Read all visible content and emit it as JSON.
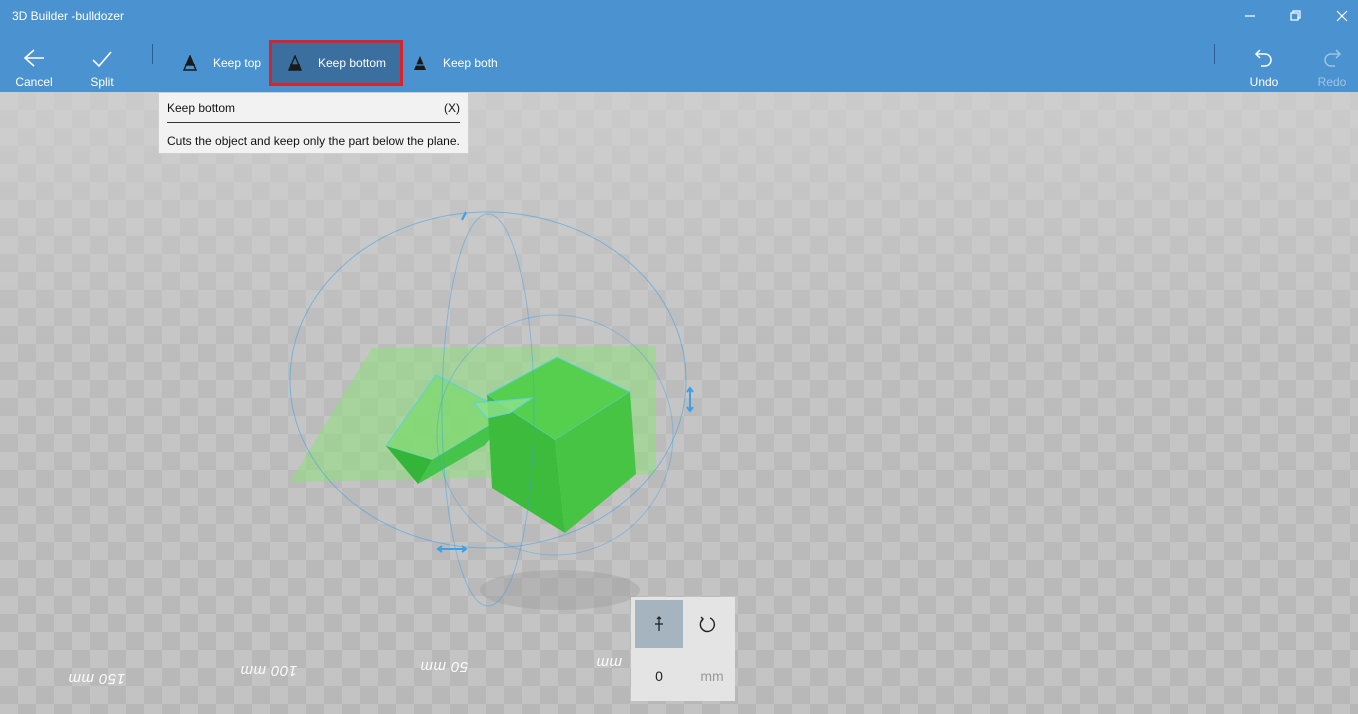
{
  "window": {
    "title": "3D Builder -bulldozer",
    "controls": [
      "minimize-icon",
      "restore-icon",
      "close-icon"
    ]
  },
  "toolbar": {
    "cancel_label": "Cancel",
    "split_label": "Split",
    "keep_top_label": "Keep top",
    "keep_bottom_label": "Keep bottom",
    "keep_both_label": "Keep both",
    "undo_label": "Undo",
    "redo_label": "Redo",
    "selected": "Keep bottom"
  },
  "tooltip": {
    "title": "Keep bottom",
    "shortcut": "(X)",
    "description": "Cuts the object and keep only the part below the plane."
  },
  "viewport": {
    "ruler_labels": [
      "150 mm",
      "100 mm",
      "50 mm",
      "mm"
    ]
  },
  "transform_panel": {
    "mode_move_icon": "move-icon",
    "mode_rotate_icon": "rotate-icon",
    "value": "0",
    "unit": "mm"
  },
  "colors": {
    "accent": "#4a93d0",
    "highlight_border": "#d8232a",
    "object_green": "#4fd14a",
    "gizmo_blue": "#3aa0e8"
  }
}
